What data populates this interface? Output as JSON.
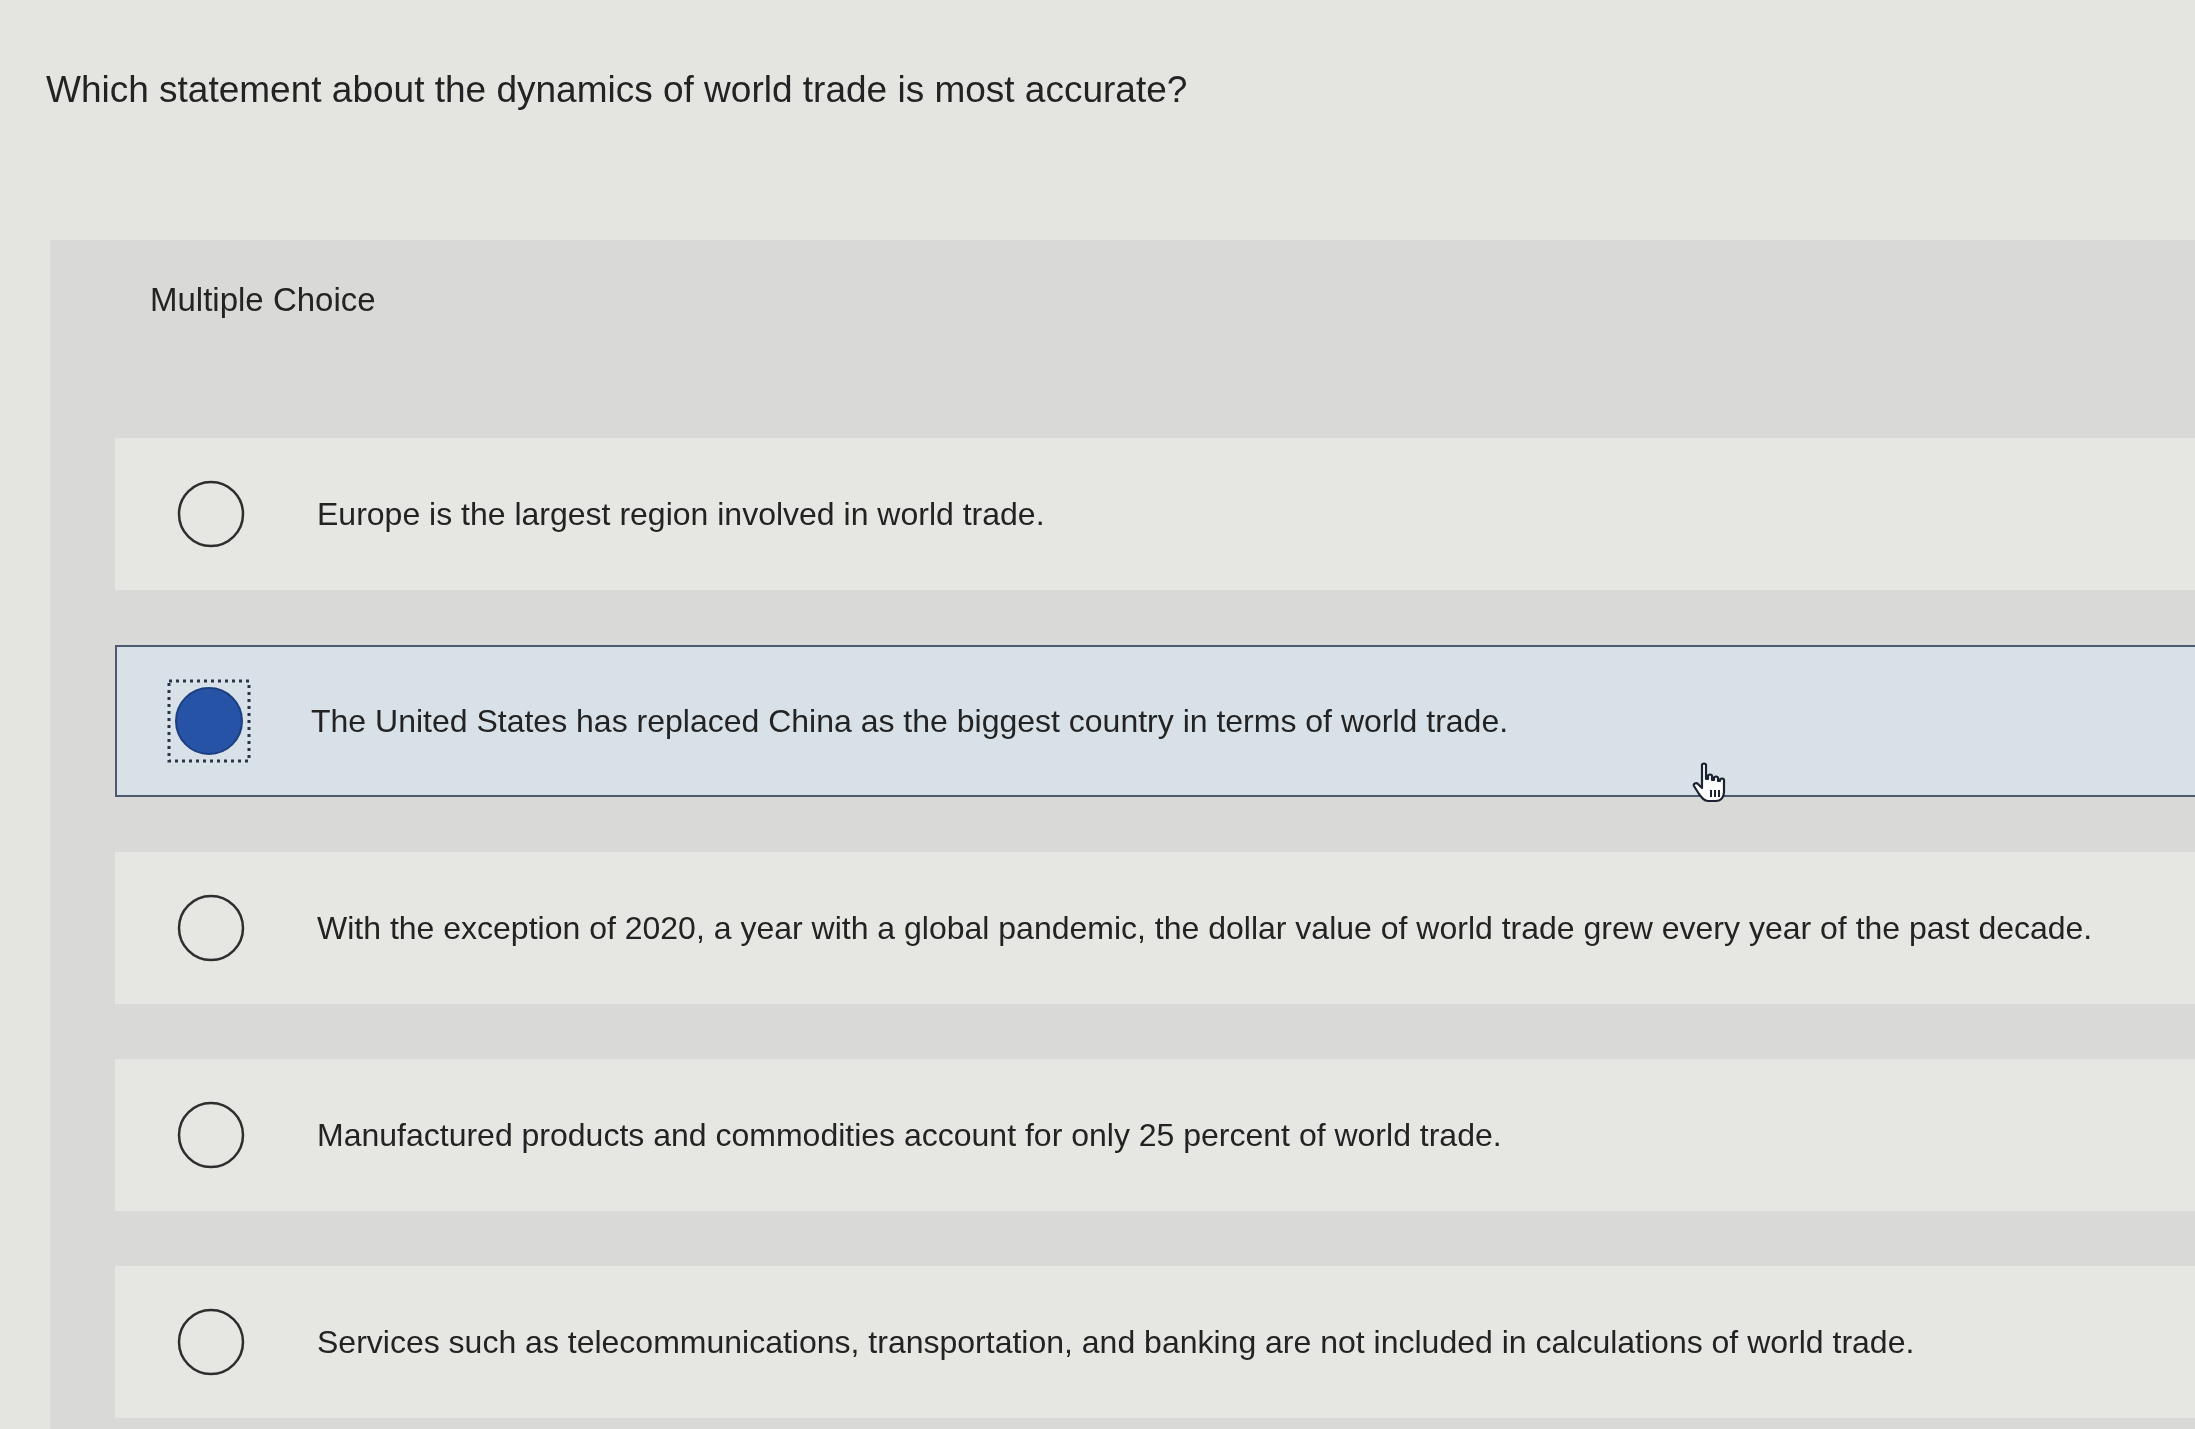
{
  "question": "Which statement about the dynamics of world trade is most accurate?",
  "panel": {
    "heading": "Multiple Choice",
    "options": [
      {
        "text": "Europe is the largest region involved in world trade.",
        "selected": false
      },
      {
        "text": "The United States has replaced China as the biggest country in terms of world trade.",
        "selected": true
      },
      {
        "text": "With the exception of 2020, a year with a global pandemic, the dollar value of world trade grew every year of the past decade.",
        "selected": false
      },
      {
        "text": "Manufactured products and commodities account for only 25 percent of world trade.",
        "selected": false
      },
      {
        "text": "Services such as telecommunications, transportation, and banking are not included in calculations of world trade.",
        "selected": false
      }
    ]
  }
}
